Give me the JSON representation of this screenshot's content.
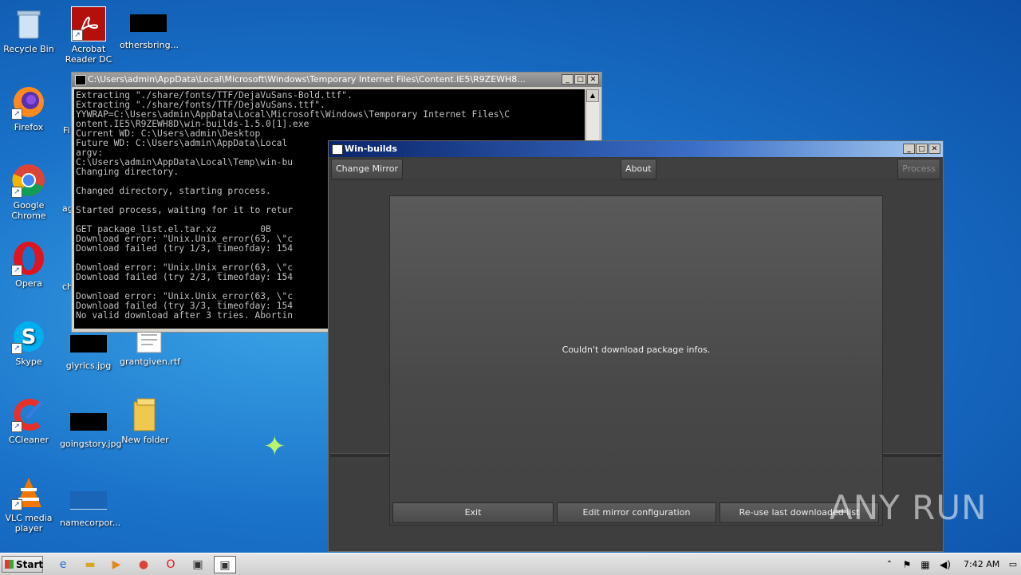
{
  "desktop": {
    "icons": [
      {
        "label": "Recycle Bin",
        "icon": "recycle-bin-icon"
      },
      {
        "label": "Acrobat Reader DC",
        "icon": "acrobat-reader-icon"
      },
      {
        "label": "othersbring...",
        "icon": "file-thumbnail-icon"
      },
      {
        "label": "Firefox",
        "icon": "firefox-icon"
      },
      {
        "label": "Google Chrome",
        "icon": "chrome-icon"
      },
      {
        "label": "Opera",
        "icon": "opera-icon"
      },
      {
        "label": "Skype",
        "icon": "skype-icon"
      },
      {
        "label": "glyrics.jpg",
        "icon": "image-file-icon"
      },
      {
        "label": "grantgiven.rtf",
        "icon": "rtf-file-icon"
      },
      {
        "label": "CCleaner",
        "icon": "ccleaner-icon"
      },
      {
        "label": "goingstory.jpg",
        "icon": "image-file-icon"
      },
      {
        "label": "New folder",
        "icon": "folder-icon"
      },
      {
        "label": "VLC media player",
        "icon": "vlc-icon"
      },
      {
        "label": "namecorpor...",
        "icon": "file-thumbnail-icon"
      }
    ],
    "partial_labels": [
      "Fi",
      "ag",
      "ch"
    ]
  },
  "console": {
    "title": "C:\\Users\\admin\\AppData\\Local\\Microsoft\\Windows\\Temporary Internet Files\\Content.IE5\\R9ZEWH8...",
    "text": "Extracting \"./share/fonts/TTF/DejaVuSans-Bold.ttf\".\nExtracting \"./share/fonts/TTF/DejaVuSans.ttf\".\nYYWRAP=C:\\Users\\admin\\AppData\\Local\\Microsoft\\Windows\\Temporary Internet Files\\C\nontent.IE5\\R9ZEWH8D\\win-builds-1.5.0[1].exe\nCurrent WD: C:\\Users\\admin\\Desktop\nFuture WD: C:\\Users\\admin\\AppData\\Local\nargv:\nC:\\Users\\admin\\AppData\\Local\\Temp\\win-bu\nChanging directory.\n\nChanged directory, starting process.\n\nStarted process, waiting for it to retur\n\nGET package_list.el.tar.xz        0B\nDownload error: \"Unix.Unix_error(63, \\\"c\nDownload failed (try 1/3, timeofday: 154\n\nDownload error: \"Unix.Unix_error(63, \\\"c\nDownload failed (try 2/3, timeofday: 154\n\nDownload error: \"Unix.Unix_error(63, \\\"c\nDownload failed (try 3/3, timeofday: 154\nNo valid download after 3 tries. Abortin"
  },
  "winbuilds": {
    "title": "Win-builds",
    "toolbar": {
      "change_mirror": "Change Mirror",
      "about": "About",
      "process": "Process"
    },
    "message": "Couldn't download package infos.",
    "buttons": {
      "exit": "Exit",
      "edit_mirror": "Edit mirror configuration",
      "reuse": "Re-use last downloaded list"
    }
  },
  "watermark": "ANY RUN",
  "taskbar": {
    "start": "Start",
    "clock": "7:42 AM"
  }
}
